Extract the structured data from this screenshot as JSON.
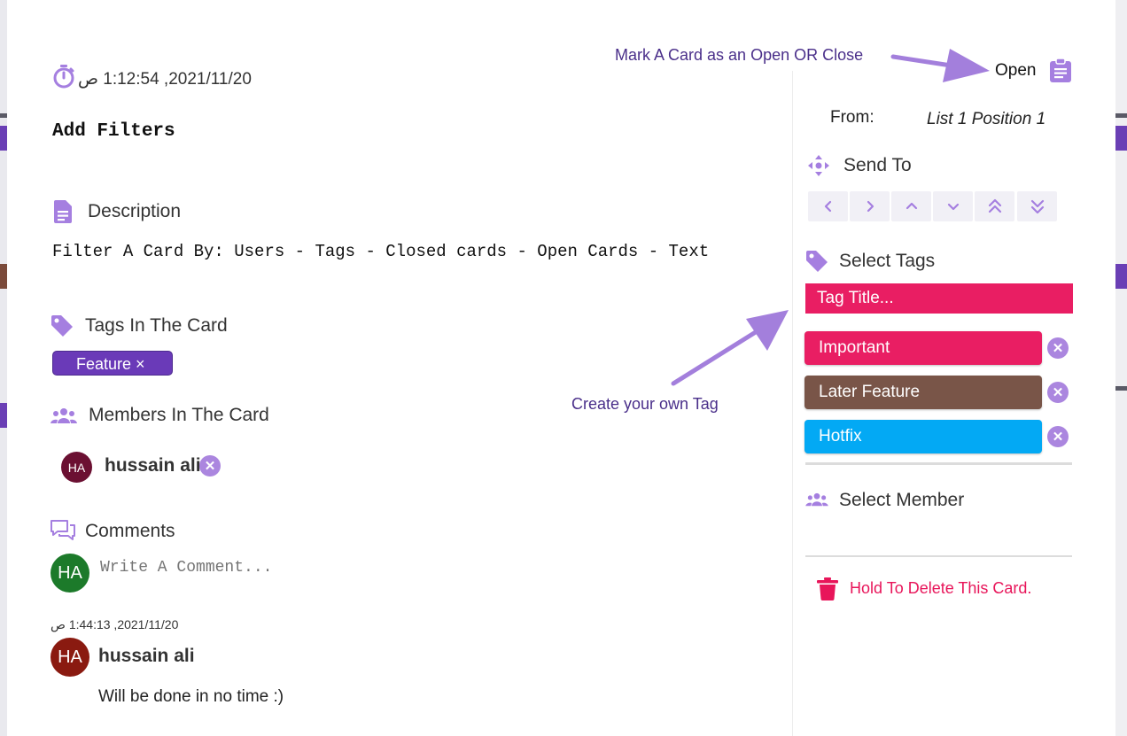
{
  "card": {
    "timestamp": "2021/11/20, 1:12:54 ص",
    "title": "Add Filters",
    "description_label": "Description",
    "description_text": "Filter A Card By: Users - Tags - Closed cards - Open Cards - Text",
    "tags_label": "Tags In The Card",
    "tags": [
      {
        "label": "Feature ×",
        "color": "#6a3ab8"
      }
    ],
    "members_label": "Members In The Card",
    "members": [
      {
        "initials": "HA",
        "name": "hussain ali",
        "color": "#6b1032"
      }
    ],
    "comments_label": "Comments",
    "comment_input": {
      "placeholder": "Write A Comment...",
      "avatar_initials": "HA",
      "avatar_color": "#1c7a2a"
    },
    "comments": [
      {
        "timestamp": "2021/11/20, 1:44:13 ص",
        "initials": "HA",
        "author": "hussain ali",
        "text": "Will be done in no time :)",
        "avatar_color": "#8a1a10"
      }
    ]
  },
  "sidebar": {
    "status_label": "Open",
    "from_label": "From:",
    "from_value": "List 1 Position 1",
    "send_to_label": "Send To",
    "send_buttons": [
      "chevron-left-icon",
      "chevron-right-icon",
      "chevron-up-icon",
      "chevron-down-icon",
      "double-chevron-up-icon",
      "double-chevron-down-icon"
    ],
    "select_tags_label": "Select Tags",
    "tag_title_placeholder": "Tag Title...",
    "tag_title_color": "#e91e63",
    "tag_options": [
      {
        "label": "Important",
        "color": "#e91e63"
      },
      {
        "label": "Later Feature",
        "color": "#795548"
      },
      {
        "label": "Hotfix",
        "color": "#03a9f4"
      }
    ],
    "select_member_label": "Select Member",
    "delete_label": "Hold To Delete This Card.",
    "delete_color": "#e8155a"
  },
  "annotations": {
    "open_close": "Mark A Card as an Open OR Close",
    "create_tag": "Create your own Tag"
  },
  "colors": {
    "accent": "#a57fe0",
    "annotation_arrow": "#a37fdc"
  }
}
